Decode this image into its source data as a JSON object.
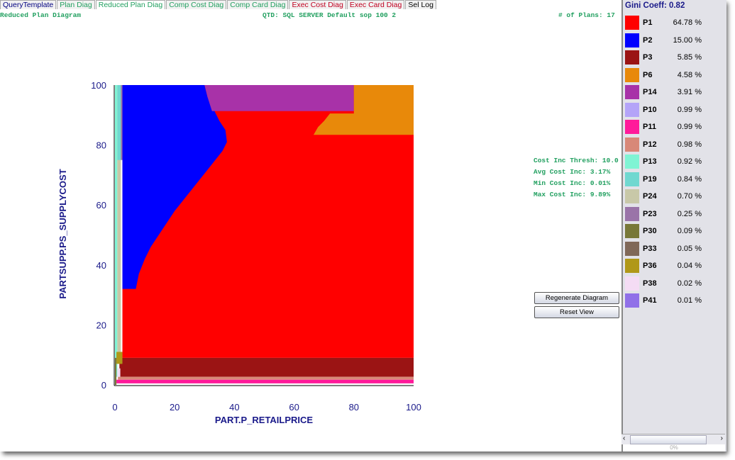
{
  "tabs": [
    {
      "label": "QueryTemplate",
      "color": "#000080"
    },
    {
      "label": "Plan Diag",
      "color": "#22a060"
    },
    {
      "label": "Reduced Plan Diag",
      "color": "#22a060"
    },
    {
      "label": "Comp Cost Diag",
      "color": "#22a060"
    },
    {
      "label": "Comp Card Diag",
      "color": "#22a060"
    },
    {
      "label": "Exec Cost Diag",
      "color": "#c00020"
    },
    {
      "label": "Exec Card Diag",
      "color": "#c00020"
    },
    {
      "label": "Sel Log",
      "color": "#000"
    }
  ],
  "header": {
    "title": "Reduced Plan Diagram",
    "qtd": "QTD: SQL SERVER Default sop 100 2",
    "plans": "# of Plans: 17"
  },
  "stats": {
    "thresh": "Cost Inc Thresh: 10.0",
    "avg": "Avg Cost Inc: 3.17%",
    "min": "Min Cost Inc: 0.01%",
    "max": "Max Cost Inc: 9.89%"
  },
  "buttons": {
    "regenerate": "Regenerate Diagram",
    "reset": "Reset View"
  },
  "legend": {
    "gini": "Gini Coeff: 0.82",
    "items": [
      {
        "plan": "P1",
        "pct": "64.78 %",
        "color": "#ff0000"
      },
      {
        "plan": "P2",
        "pct": "15.00 %",
        "color": "#0000ff"
      },
      {
        "plan": "P3",
        "pct": "5.85 %",
        "color": "#9b1414"
      },
      {
        "plan": "P6",
        "pct": "4.58 %",
        "color": "#e8890a"
      },
      {
        "plan": "P14",
        "pct": "3.91 %",
        "color": "#a832a8"
      },
      {
        "plan": "P10",
        "pct": "0.99 %",
        "color": "#b4a4f8"
      },
      {
        "plan": "P11",
        "pct": "0.99 %",
        "color": "#ff1a9a"
      },
      {
        "plan": "P12",
        "pct": "0.98 %",
        "color": "#d88878"
      },
      {
        "plan": "P13",
        "pct": "0.92 %",
        "color": "#80f4d4"
      },
      {
        "plan": "P19",
        "pct": "0.84 %",
        "color": "#70d8d0"
      },
      {
        "plan": "P24",
        "pct": "0.70 %",
        "color": "#c8c8a8"
      },
      {
        "plan": "P23",
        "pct": "0.25 %",
        "color": "#9a74a8"
      },
      {
        "plan": "P30",
        "pct": "0.09 %",
        "color": "#787838"
      },
      {
        "plan": "P33",
        "pct": "0.05 %",
        "color": "#806858"
      },
      {
        "plan": "P36",
        "pct": "0.04 %",
        "color": "#b09818"
      },
      {
        "plan": "P38",
        "pct": "0.02 %",
        "color": "#f4dcf4"
      },
      {
        "plan": "P41",
        "pct": "0.01 %",
        "color": "#9070e8"
      }
    ]
  },
  "progress": "0%",
  "chart_data": {
    "type": "area",
    "xlabel": "PART.P_RETAILPRICE",
    "ylabel": "PARTSUPP.PS_SUPPLYCOST",
    "xlim": [
      0,
      100
    ],
    "ylim": [
      0,
      100
    ],
    "xticks": [
      0,
      20,
      40,
      60,
      80,
      100
    ],
    "yticks": [
      0,
      20,
      40,
      60,
      80,
      100
    ],
    "regions": [
      {
        "plan": "P1",
        "color": "#ff0000",
        "points": [
          [
            2.5,
            9
          ],
          [
            100,
            9
          ],
          [
            100,
            100
          ],
          [
            2.5,
            100
          ]
        ]
      },
      {
        "plan": "P3",
        "color": "#9b1414",
        "points": [
          [
            1.5,
            2.7
          ],
          [
            100,
            2.7
          ],
          [
            100,
            9
          ],
          [
            1.5,
            9
          ]
        ]
      },
      {
        "plan": "P12",
        "color": "#d88878",
        "points": [
          [
            1,
            1.7
          ],
          [
            100,
            1.7
          ],
          [
            100,
            2.7
          ],
          [
            1,
            2.7
          ]
        ]
      },
      {
        "plan": "P11",
        "color": "#ff1a9a",
        "points": [
          [
            0.5,
            0.5
          ],
          [
            100,
            0.5
          ],
          [
            100,
            1.7
          ],
          [
            0.5,
            1.7
          ]
        ]
      },
      {
        "plan": "P2",
        "color": "#0000ff",
        "points": [
          [
            2.5,
            100
          ],
          [
            30,
            100
          ],
          [
            31,
            96
          ],
          [
            33,
            92
          ],
          [
            35,
            88
          ],
          [
            37,
            85
          ],
          [
            37.5,
            81
          ],
          [
            36,
            78
          ],
          [
            32,
            73
          ],
          [
            28,
            68
          ],
          [
            24,
            63
          ],
          [
            20,
            58
          ],
          [
            16,
            52
          ],
          [
            12,
            46
          ],
          [
            10,
            42
          ],
          [
            8,
            37
          ],
          [
            7,
            32
          ],
          [
            2.5,
            32
          ]
        ]
      },
      {
        "plan": "P14",
        "color": "#a832a8",
        "points": [
          [
            30,
            100
          ],
          [
            80,
            100
          ],
          [
            80,
            91.3
          ],
          [
            32.5,
            91.3
          ],
          [
            31,
            96
          ]
        ]
      },
      {
        "plan": "P6",
        "color": "#e8890a",
        "points": [
          [
            80,
            100
          ],
          [
            100,
            100
          ],
          [
            100,
            83.4
          ],
          [
            66.5,
            83.4
          ],
          [
            68,
            86
          ],
          [
            70,
            88
          ],
          [
            72,
            90.5
          ],
          [
            80,
            90.5
          ]
        ]
      },
      {
        "plan": "P13",
        "color": "#80f4d4",
        "points": [
          [
            0,
            2.7
          ],
          [
            0.8,
            2.7
          ],
          [
            0.8,
            100
          ],
          [
            0,
            100
          ]
        ]
      },
      {
        "plan": "P24",
        "color": "#c8c8a8",
        "points": [
          [
            0.8,
            9
          ],
          [
            2,
            9
          ],
          [
            2,
            100
          ],
          [
            0.8,
            100
          ]
        ]
      },
      {
        "plan": "P19",
        "color": "#70d8d0",
        "points": [
          [
            0.8,
            75
          ],
          [
            2,
            75
          ],
          [
            2,
            100
          ],
          [
            0.8,
            100
          ]
        ]
      },
      {
        "plan": "P23",
        "color": "#9a74a8",
        "points": [
          [
            2,
            75
          ],
          [
            2.5,
            75
          ],
          [
            2.5,
            100
          ],
          [
            2,
            100
          ]
        ]
      },
      {
        "plan": "P36",
        "color": "#b09818",
        "points": [
          [
            0.5,
            7
          ],
          [
            2.5,
            7
          ],
          [
            2.5,
            11
          ],
          [
            0.5,
            11
          ]
        ]
      },
      {
        "plan": "P38",
        "color": "#f4dcf4",
        "points": [
          [
            0.8,
            2.7
          ],
          [
            1.8,
            2.7
          ],
          [
            1.8,
            5.5
          ],
          [
            0.8,
            5.5
          ]
        ]
      },
      {
        "plan": "P30",
        "color": "#787838",
        "points": [
          [
            0,
            0
          ],
          [
            0.5,
            0
          ],
          [
            0.5,
            9
          ],
          [
            0,
            9
          ]
        ]
      }
    ]
  }
}
